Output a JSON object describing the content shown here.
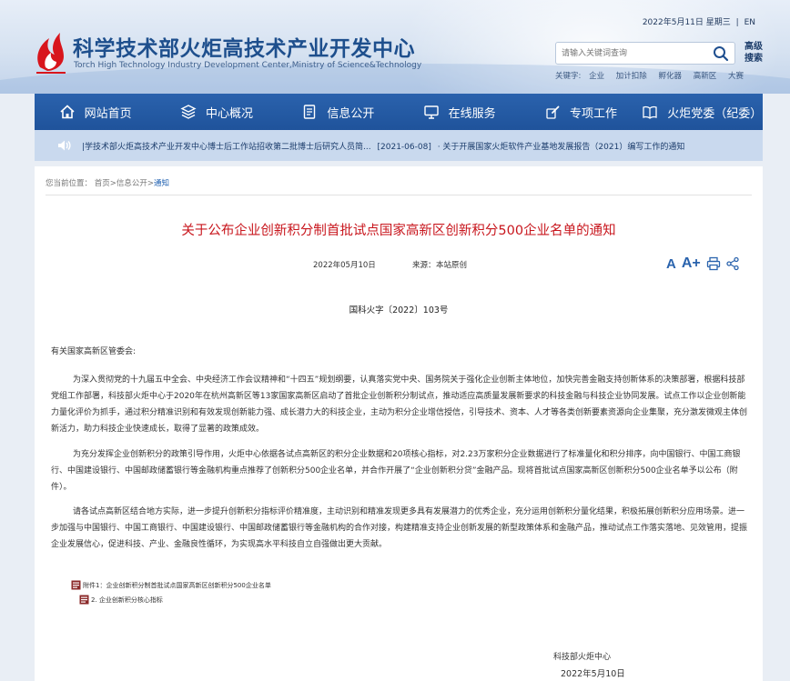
{
  "header": {
    "title": "科学技术部火炬高技术产业开发中心",
    "subtitle": "Torch High Technology Industry Development Center,Ministry of Science&Technology",
    "date_weekday": "2022年5月11日 星期三",
    "sep": "|",
    "lang": "EN",
    "search": {
      "placeholder": "请输入关键词查询",
      "advanced_label": "高级搜索"
    },
    "keywords_label": "关键字:",
    "keywords": [
      "企业",
      "加计扣除",
      "孵化器",
      "高新区",
      "大赛"
    ]
  },
  "nav": {
    "items": [
      {
        "label": "网站首页",
        "icon": "home-icon"
      },
      {
        "label": "中心概况",
        "icon": "layers-icon"
      },
      {
        "label": "信息公开",
        "icon": "document-icon"
      },
      {
        "label": "在线服务",
        "icon": "monitor-icon"
      },
      {
        "label": "专项工作",
        "icon": "pen-icon"
      },
      {
        "label": "火炬党委（纪委）",
        "icon": "book-icon"
      }
    ]
  },
  "ticker": {
    "text1": "|学技术部火炬高技术产业开发中心博士后工作站招收第二批博士后研究人员简...",
    "date2": "[2021-06-08]",
    "text2": "· 关于开展国家火炬软件产业基地发展报告（2021）编写工作的通知"
  },
  "breadcrumb": {
    "label": "您当前位置：",
    "items": [
      "首页",
      "信息公开",
      "通知"
    ],
    "sep": ">"
  },
  "article": {
    "title": "关于公布企业创新积分制首批试点国家高新区创新积分500企业名单的通知",
    "date": "2022年05月10日",
    "source_label": "来源：",
    "source": "本站原创",
    "tools": {
      "font_up": "A+",
      "font_down": "A"
    },
    "docno": "国科火字〔2022〕103号",
    "salutation": "有关国家高新区管委会:",
    "paragraphs": [
      "为深入贯彻党的十九届五中全会、中央经济工作会议精神和“十四五”规划纲要，认真落实党中央、国务院关于强化企业创新主体地位，加快完善金融支持创新体系的决策部署，根据科技部党组工作部署，科技部火炬中心于2020年在杭州高新区等13家国家高新区启动了首批企业创新积分制试点，推动适应高质量发展新要求的科技金融与科技企业协同发展。试点工作以企业创新能力量化评价为抓手，通过积分精准识别和有效发现创新能力强、成长潜力大的科技企业，主动为积分企业增信授信，引导技术、资本、人才等各类创新要素资源向企业集聚，充分激发微观主体创新活力，助力科技企业快速成长，取得了显著的政策成效。",
      "为充分发挥企业创新积分的政策引导作用，火炬中心依据各试点高新区的积分企业数据和20项核心指标，对2.23万家积分企业数据进行了标准量化和积分排序，向中国银行、中国工商银行、中国建设银行、中国邮政储蓄银行等金融机构重点推荐了创新积分500企业名单，并合作开展了“企业创新积分贷”金融产品。现将首批试点国家高新区创新积分500企业名单予以公布（附件）。",
      "请各试点高新区结合地方实际，进一步提升创新积分指标评价精准度，主动识别和精准发现更多具有发展潜力的优秀企业，充分运用创新积分量化结果，积极拓展创新积分应用场景。进一步加强与中国银行、中国工商银行、中国建设银行、中国邮政储蓄银行等金融机构的合作对接，构建精准支持企业创新发展的新型政策体系和金融产品，推动试点工作落实落地、见效管用，提振企业发展信心，促进科技、产业、金融良性循环，为实现高水平科技自立自强做出更大贡献。"
    ],
    "attachments": [
      "附件1：企业创新积分制首批试点国家高新区创新积分500企业名单",
      "2. 企业创新积分核心指标"
    ],
    "signature": "科技部火炬中心",
    "sign_date": "2022年5月10日"
  },
  "colors": {
    "nav_bg": "#2a62ad",
    "ticker_bg": "#c9d9ee",
    "title_red": "#c8161d",
    "link_blue": "#1e5fb0"
  }
}
